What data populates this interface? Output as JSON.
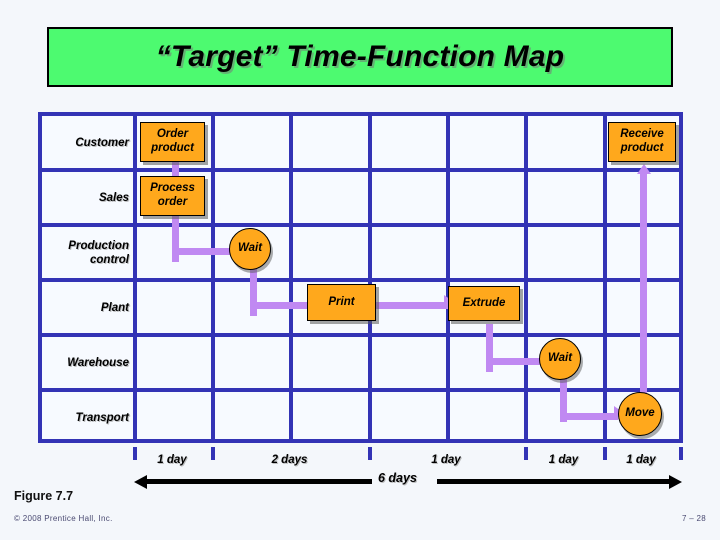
{
  "slide": {
    "title": "“Target” Time-Function Map",
    "title_bg": "#4dfa70",
    "grid_color": "#3333b5",
    "node_color": "#ffa81c",
    "connector_color": "#c089f2"
  },
  "grid": {
    "rows": [
      {
        "label": "Customer"
      },
      {
        "label": "Sales"
      },
      {
        "label": "Production\ncontrol"
      },
      {
        "label": "Plant"
      },
      {
        "label": "Warehouse"
      },
      {
        "label": "Transport"
      }
    ],
    "columns": 8
  },
  "nodes": [
    {
      "id": "order-product",
      "label": "Order\nproduct",
      "shape": "rect",
      "row": "Customer"
    },
    {
      "id": "receive-product",
      "label": "Receive\nproduct",
      "shape": "rect",
      "row": "Customer"
    },
    {
      "id": "process-order",
      "label": "Process\norder",
      "shape": "rect",
      "row": "Sales"
    },
    {
      "id": "wait-production",
      "label": "Wait",
      "shape": "circle",
      "row": "Production control"
    },
    {
      "id": "print",
      "label": "Print",
      "shape": "rect",
      "row": "Plant"
    },
    {
      "id": "extrude",
      "label": "Extrude",
      "shape": "rect",
      "row": "Plant"
    },
    {
      "id": "wait-warehouse",
      "label": "Wait",
      "shape": "circle",
      "row": "Warehouse"
    },
    {
      "id": "move",
      "label": "Move",
      "shape": "circle",
      "row": "Transport"
    }
  ],
  "timeline": {
    "segments": [
      {
        "label": "1 day"
      },
      {
        "label": "2 days"
      },
      {
        "label": "1 day"
      },
      {
        "label": "1 day"
      },
      {
        "label": "1 day"
      }
    ],
    "total": "6 days"
  },
  "footer": {
    "figure": "Figure 7.7",
    "copyright": "© 2008 Prentice Hall, Inc.",
    "page": "7 – 28"
  }
}
